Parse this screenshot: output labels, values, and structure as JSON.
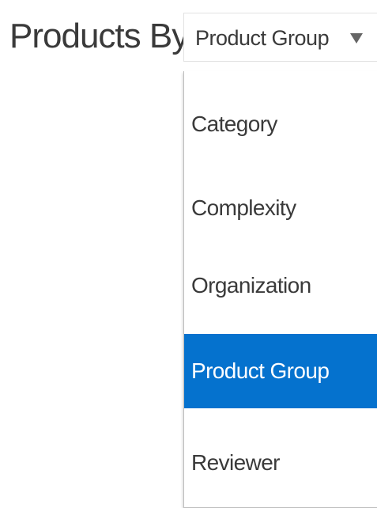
{
  "label": "Products By",
  "select": {
    "value": "Product Group",
    "icon": "chevron-down-icon"
  },
  "options": [
    {
      "label": "Category",
      "selected": false
    },
    {
      "label": "Complexity",
      "selected": false
    },
    {
      "label": "Organization",
      "selected": false
    },
    {
      "label": "Product Group",
      "selected": true
    },
    {
      "label": "Reviewer",
      "selected": false
    }
  ],
  "colors": {
    "selected_background": "#0572ce",
    "selected_text": "#ffffff",
    "text": "#3a3a3a"
  }
}
